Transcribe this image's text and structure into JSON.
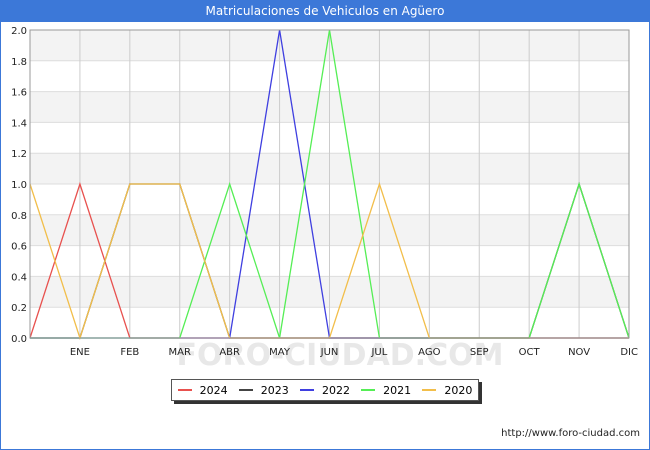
{
  "chart_data": {
    "type": "line",
    "title": "Matriculaciones de Vehiculos en Agüero",
    "xlabel": "",
    "ylabel": "",
    "ylim": [
      0,
      2.0
    ],
    "yticks": [
      "0.0",
      "0.2",
      "0.4",
      "0.6",
      "0.8",
      "1.0",
      "1.2",
      "1.4",
      "1.6",
      "1.8",
      "2.0"
    ],
    "categories": [
      "",
      "ENE",
      "FEB",
      "MAR",
      "ABR",
      "MAY",
      "JUN",
      "JUL",
      "AGO",
      "SEP",
      "OCT",
      "NOV",
      "DIC"
    ],
    "grid": true,
    "legend_position": "bottom",
    "series": [
      {
        "name": "2024",
        "color": "#e8514e",
        "values": [
          0,
          1,
          0,
          0,
          0,
          0,
          0,
          0,
          0,
          0,
          0,
          0,
          0
        ]
      },
      {
        "name": "2023",
        "color": "#444444",
        "values": [
          0,
          0,
          1,
          1,
          0,
          0,
          0,
          0,
          0,
          0,
          0,
          1,
          0
        ]
      },
      {
        "name": "2022",
        "color": "#3f3fe0",
        "values": [
          0,
          0,
          0,
          0,
          0,
          2,
          0,
          0,
          0,
          0,
          0,
          0,
          0
        ]
      },
      {
        "name": "2021",
        "color": "#55ee55",
        "values": [
          0,
          0,
          0,
          0,
          1,
          0,
          2,
          0,
          0,
          0,
          0,
          1,
          0
        ]
      },
      {
        "name": "2020",
        "color": "#f2be4a",
        "values": [
          1,
          0,
          1,
          1,
          0,
          0,
          0,
          1,
          0,
          0,
          0,
          0,
          0
        ]
      }
    ],
    "watermark": "FORO-CIUDAD.COM"
  },
  "footer": {
    "url": "http://www.foro-ciudad.com"
  }
}
